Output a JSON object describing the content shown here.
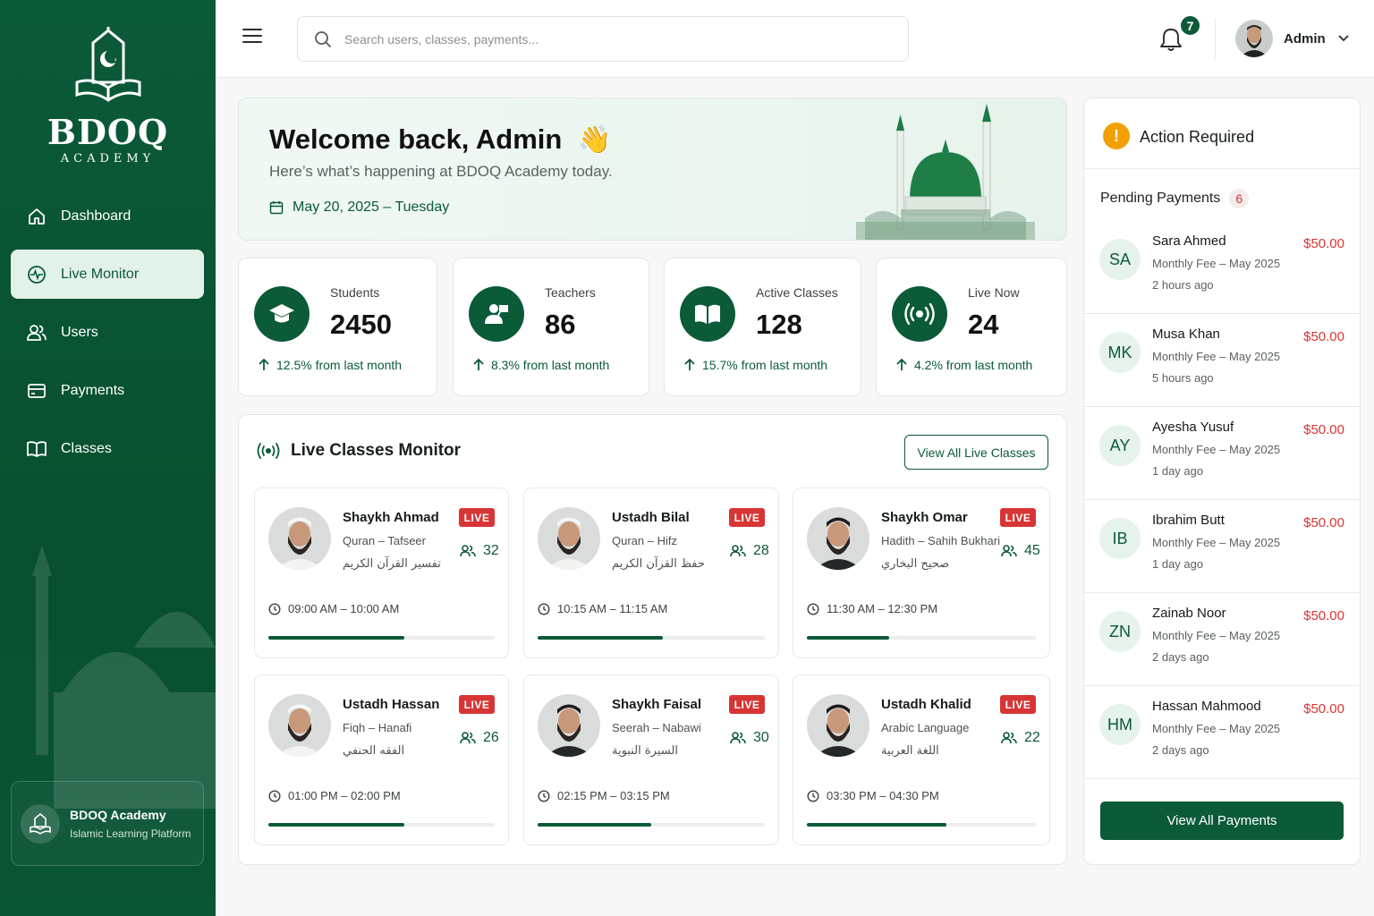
{
  "brand": {
    "name": "BDOQ",
    "subtitle": "ACADEMY"
  },
  "sidebar": {
    "items": [
      {
        "label": "Dashboard",
        "icon": "home-icon"
      },
      {
        "label": "Live Monitor",
        "icon": "live-monitor-icon",
        "active": true
      },
      {
        "label": "Users",
        "icon": "users-icon"
      },
      {
        "label": "Payments",
        "icon": "payments-icon"
      },
      {
        "label": "Classes",
        "icon": "book-icon"
      }
    ],
    "footer": {
      "title": "BDOQ Academy",
      "subtitle": "Islamic Learning Platform"
    }
  },
  "topbar": {
    "search_placeholder": "Search users, classes, payments...",
    "notifications": "7",
    "user": "Admin"
  },
  "welcome": {
    "title": "Welcome back, Admin",
    "emoji": "👋",
    "subtitle": "Here’s what’s happening at BDOQ Academy today.",
    "date": "May 20, 2025 – Tuesday"
  },
  "stats": [
    {
      "label": "Students",
      "value": "2450",
      "change": "12.5% from last month",
      "icon": "graduation-cap-icon"
    },
    {
      "label": "Teachers",
      "value": "86",
      "change": "8.3% from last month",
      "icon": "teacher-icon"
    },
    {
      "label": "Active Classes",
      "value": "128",
      "change": "15.7% from last month",
      "icon": "open-book-icon"
    },
    {
      "label": "Live Now",
      "value": "24",
      "change": "4.2%  from last month",
      "icon": "broadcast-icon"
    }
  ],
  "live_monitor": {
    "title": "Live Classes Monitor",
    "button": "View All Live Classes",
    "live_label": "LIVE",
    "classes": [
      {
        "teacher": "Shaykh Ahmad",
        "subject": "Quran – Tafseer",
        "arabic": "تفسير القرآن الكريم",
        "students": "32",
        "time": "09:00 AM – 10:00 AM",
        "progress": 0.6
      },
      {
        "teacher": "Ustadh Bilal",
        "subject": "Quran – Hifz",
        "arabic": "حفظ القرآن الكريم",
        "students": "28",
        "time": "10:15 AM – 11:15 AM",
        "progress": 0.55
      },
      {
        "teacher": "Shaykh Omar",
        "subject": "Hadith – Sahih Bukhari",
        "arabic": "صحيح البخاري",
        "students": "45",
        "time": "11:30 AM – 12:30 PM",
        "progress": 0.36
      },
      {
        "teacher": "Ustadh Hassan",
        "subject": "Fiqh – Hanafi",
        "arabic": "الفقه الحنفي",
        "students": "26",
        "time": "01:00 PM – 02:00 PM",
        "progress": 0.6
      },
      {
        "teacher": "Shaykh Faisal",
        "subject": "Seerah – Nabawi",
        "arabic": "السيرة النبوية",
        "students": "30",
        "time": "02:15 PM – 03:15 PM",
        "progress": 0.5
      },
      {
        "teacher": "Ustadh Khalid",
        "subject": "Arabic Language",
        "arabic": "اللغة العربية",
        "students": "22",
        "time": "03:30 PM – 04:30 PM",
        "progress": 0.61
      }
    ]
  },
  "action_required": {
    "title": "Action Required",
    "pending_label": "Pending Payments",
    "pending_count": "6",
    "payments": [
      {
        "initials": "SA",
        "name": "Sara Ahmed",
        "desc": "Monthly Fee – May 2025",
        "time": "2 hours ago",
        "amount": "$50.00"
      },
      {
        "initials": "MK",
        "name": "Musa Khan",
        "desc": "Monthly Fee – May 2025",
        "time": "5 hours ago",
        "amount": "$50.00"
      },
      {
        "initials": "AY",
        "name": "Ayesha Yusuf",
        "desc": "Monthly Fee – May 2025",
        "time": "1 day ago",
        "amount": "$50.00"
      },
      {
        "initials": "IB",
        "name": "Ibrahim Butt",
        "desc": "Monthly Fee – May 2025",
        "time": "1 day ago",
        "amount": "$50.00"
      },
      {
        "initials": "ZN",
        "name": "Zainab Noor",
        "desc": "Monthly Fee – May 2025",
        "time": "2 days ago",
        "amount": "$50.00"
      },
      {
        "initials": "HM",
        "name": "Hassan Mahmood",
        "desc": "Monthly Fee – May 2025",
        "time": "2 days ago",
        "amount": "$50.00"
      }
    ],
    "button": "View All Payments"
  },
  "colors": {
    "primary": "#0b5a38",
    "live": "#d73535",
    "warning": "#f2a006"
  }
}
